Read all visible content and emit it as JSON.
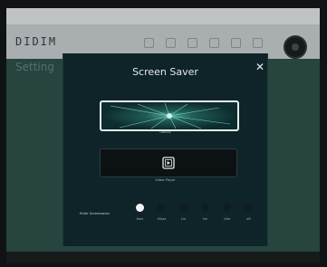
{
  "header": {
    "logo": "DIDIM"
  },
  "background_page": {
    "title": "Setting"
  },
  "modal": {
    "title": "Screen Saver",
    "close_symbol": "✕",
    "options": [
      {
        "caption": "Galaxy",
        "icon": "galaxy-preview"
      },
      {
        "caption": "Video Player",
        "icon": "film-icon"
      }
    ],
    "sleep": {
      "label": "Enter Screensaver",
      "options": [
        "8sec",
        "30sec",
        "1m",
        "5m",
        "10m",
        "off"
      ],
      "selected_index": 0
    }
  },
  "colors": {
    "modal_bg": "#0e2428",
    "page_bg": "#27443f",
    "selected": "#f2f4f4",
    "unselected": "#131c1d"
  }
}
